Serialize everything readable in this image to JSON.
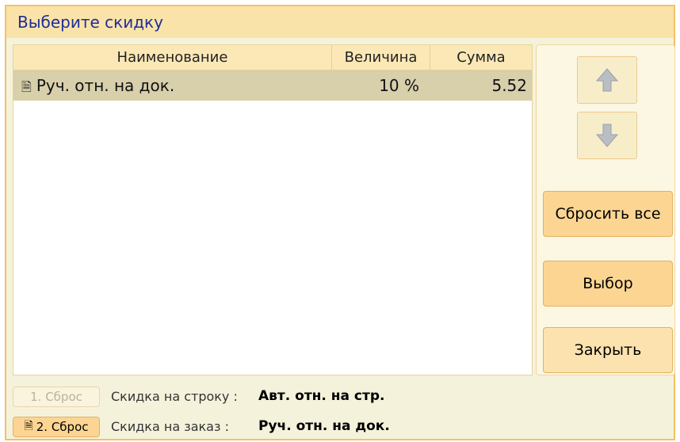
{
  "window": {
    "title": "Выберите скидку"
  },
  "table": {
    "columns": [
      "Наименование",
      "Величина",
      "Сумма"
    ],
    "rows": [
      {
        "name": "Руч. отн. на док.",
        "value": "10 %",
        "sum": "5.52"
      }
    ]
  },
  "buttons": {
    "reset_all": "Сбросить все",
    "select": "Выбор",
    "close": "Закрыть"
  },
  "footer": {
    "line_reset_button": "1. Сброс",
    "line_label": "Скидка на строку :",
    "line_value": "Авт. отн. на стр.",
    "order_reset_button": "2. Сброс",
    "order_label": "Скидка на заказ :",
    "order_value": "Руч. отн. на док."
  },
  "colors": {
    "title_text": "#1e2d98",
    "selected_row": "#d8cfab",
    "button_orange": "#fcd593"
  },
  "icons": [
    "document-icon",
    "arrow-up-icon",
    "arrow-down-icon"
  ]
}
